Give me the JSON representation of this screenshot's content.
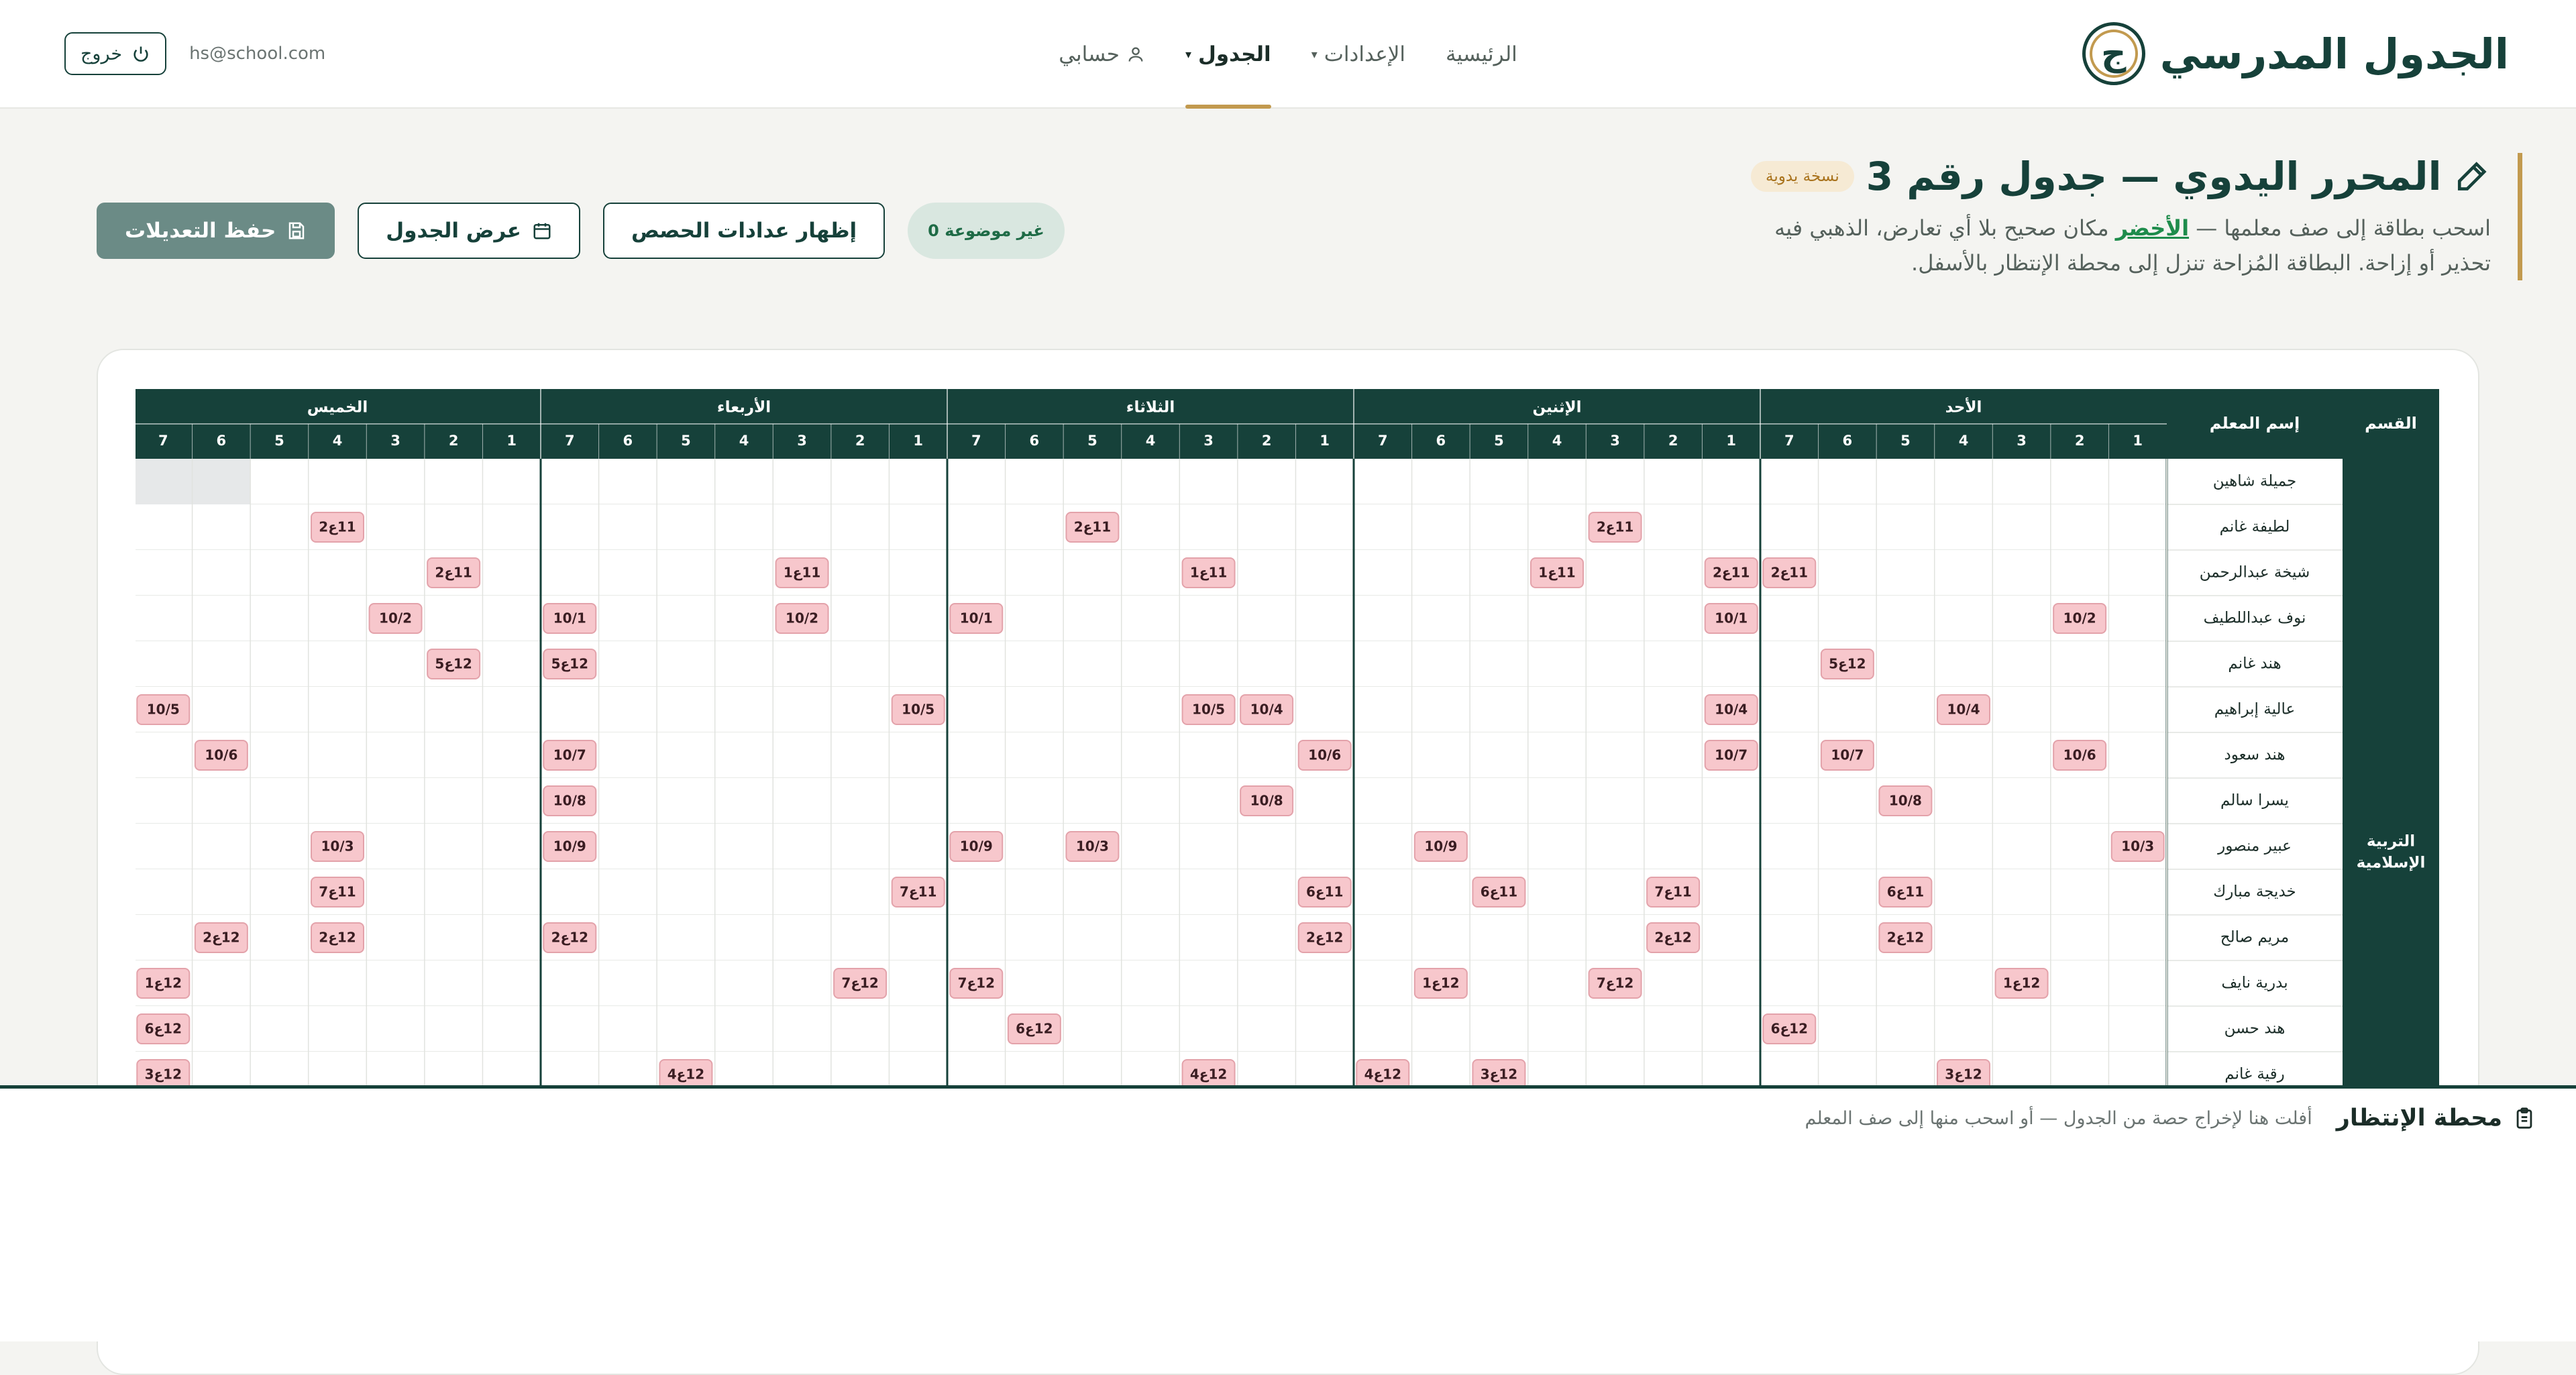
{
  "app": {
    "logo_text": "الجدول المدرسي",
    "logo_letter": "ج"
  },
  "nav": {
    "home": "الرئيسية",
    "settings": "الإعدادات",
    "schedule": "الجدول",
    "account": "حسابي"
  },
  "user": {
    "email": "hs@school.com",
    "logout_label": "خروج"
  },
  "editor": {
    "title": "المحرر اليدوي — جدول رقم 3",
    "badge": "نسخة يدوية",
    "desc_part1": "اسحب بطاقة إلى صف معلمها — ",
    "desc_green": "الأخضر",
    "desc_part2": " مكان صحيح بلا أي تعارض، الذهبي فيه تحذير أو إزاحة. البطاقة المُزاحة تنزل إلى محطة الإنتظار بالأسفل."
  },
  "actions": {
    "save": "حفظ التعديلات",
    "view": "عرض الجدول",
    "show_counts": "إظهار عدادات الحصص",
    "unplaced": "0 غير موضوعة"
  },
  "table": {
    "department_header": "القسم",
    "teacher_header": "إسم المعلم",
    "department_name": "التربية الإسلامية",
    "days": [
      "الأحد",
      "الإثنين",
      "الثلاثاء",
      "الأربعاء",
      "الخميس"
    ],
    "periods": [
      "1",
      "2",
      "3",
      "4",
      "5",
      "6",
      "7"
    ],
    "teachers": [
      {
        "name": "جميلة شاهين",
        "cells": []
      },
      {
        "name": "لطيفة غانم",
        "cells": [
          [
            1,
            3,
            "11ع2"
          ],
          [
            2,
            5,
            "11ع2"
          ],
          [
            4,
            4,
            "11ع2"
          ]
        ]
      },
      {
        "name": "شيخة عبدالرحمن",
        "cells": [
          [
            0,
            7,
            "11ع2"
          ],
          [
            1,
            1,
            "11ع2"
          ],
          [
            1,
            4,
            "11ع1"
          ],
          [
            2,
            3,
            "11ع1"
          ],
          [
            3,
            3,
            "11ع1"
          ],
          [
            4,
            2,
            "11ع2"
          ]
        ]
      },
      {
        "name": "نوف عبداللطيف",
        "cells": [
          [
            0,
            2,
            "10/2"
          ],
          [
            1,
            1,
            "10/1"
          ],
          [
            2,
            7,
            "10/1"
          ],
          [
            3,
            3,
            "10/2"
          ],
          [
            3,
            7,
            "10/1"
          ],
          [
            4,
            3,
            "10/2"
          ]
        ]
      },
      {
        "name": "هند غانم",
        "cells": [
          [
            0,
            6,
            "12ع5"
          ],
          [
            3,
            7,
            "12ع5"
          ],
          [
            4,
            2,
            "12ع5"
          ]
        ]
      },
      {
        "name": "عالية إبراهيم",
        "cells": [
          [
            0,
            4,
            "10/4"
          ],
          [
            1,
            1,
            "10/4"
          ],
          [
            2,
            2,
            "10/4"
          ],
          [
            2,
            3,
            "10/5"
          ],
          [
            3,
            1,
            "10/5"
          ],
          [
            4,
            7,
            "10/5"
          ]
        ]
      },
      {
        "name": "هند سعود",
        "cells": [
          [
            0,
            2,
            "10/6"
          ],
          [
            0,
            6,
            "10/7"
          ],
          [
            1,
            1,
            "10/7"
          ],
          [
            2,
            1,
            "10/6"
          ],
          [
            3,
            7,
            "10/7"
          ],
          [
            4,
            6,
            "10/6"
          ]
        ]
      },
      {
        "name": "يسرا سالم",
        "cells": [
          [
            0,
            5,
            "10/8"
          ],
          [
            2,
            2,
            "10/8"
          ],
          [
            3,
            7,
            "10/8"
          ]
        ]
      },
      {
        "name": "عبير منصور",
        "cells": [
          [
            0,
            1,
            "10/3"
          ],
          [
            1,
            6,
            "10/9"
          ],
          [
            2,
            5,
            "10/3"
          ],
          [
            2,
            7,
            "10/9"
          ],
          [
            3,
            7,
            "10/9"
          ],
          [
            4,
            4,
            "10/3"
          ]
        ]
      },
      {
        "name": "خديجة مبارك",
        "cells": [
          [
            0,
            5,
            "11ع6"
          ],
          [
            1,
            2,
            "11ع7"
          ],
          [
            1,
            5,
            "11ع6"
          ],
          [
            2,
            1,
            "11ع6"
          ],
          [
            3,
            1,
            "11ع7"
          ],
          [
            4,
            4,
            "11ع7"
          ]
        ]
      },
      {
        "name": "مريم صالح",
        "cells": [
          [
            0,
            5,
            "12ع2"
          ],
          [
            1,
            2,
            "12ع2"
          ],
          [
            2,
            1,
            "12ع2"
          ],
          [
            3,
            7,
            "12ع2"
          ],
          [
            4,
            4,
            "12ع2"
          ],
          [
            4,
            6,
            "12ع2"
          ]
        ]
      },
      {
        "name": "بدرية نايف",
        "cells": [
          [
            0,
            3,
            "12ع1"
          ],
          [
            1,
            3,
            "12ع7"
          ],
          [
            1,
            6,
            "12ع1"
          ],
          [
            2,
            7,
            "12ع7"
          ],
          [
            3,
            2,
            "12ع7"
          ],
          [
            4,
            7,
            "12ع1"
          ]
        ]
      },
      {
        "name": "هند حسن",
        "cells": [
          [
            0,
            7,
            "12ع6"
          ],
          [
            2,
            6,
            "12ع6"
          ],
          [
            4,
            7,
            "12ع6"
          ]
        ]
      },
      {
        "name": "رقية غانم",
        "cells": [
          [
            0,
            4,
            "12ع3"
          ],
          [
            1,
            5,
            "12ع3"
          ],
          [
            1,
            7,
            "12ع4"
          ],
          [
            2,
            3,
            "12ع4"
          ],
          [
            3,
            5,
            "12ع4"
          ],
          [
            4,
            7,
            "12ع3"
          ]
        ]
      }
    ],
    "blocked": [
      [
        0,
        4,
        6
      ],
      [
        0,
        4,
        7
      ]
    ]
  },
  "waiting": {
    "title": "محطة الإنتظار",
    "hint": "أفلت هنا لإخراج حصة من الجدول — أو اسحب منها إلى صف المعلم"
  },
  "colors": {
    "primary": "#16413a",
    "gold": "#c29a4f",
    "card_fill": "#f7c7cc",
    "card_border": "#e3a2aa"
  }
}
